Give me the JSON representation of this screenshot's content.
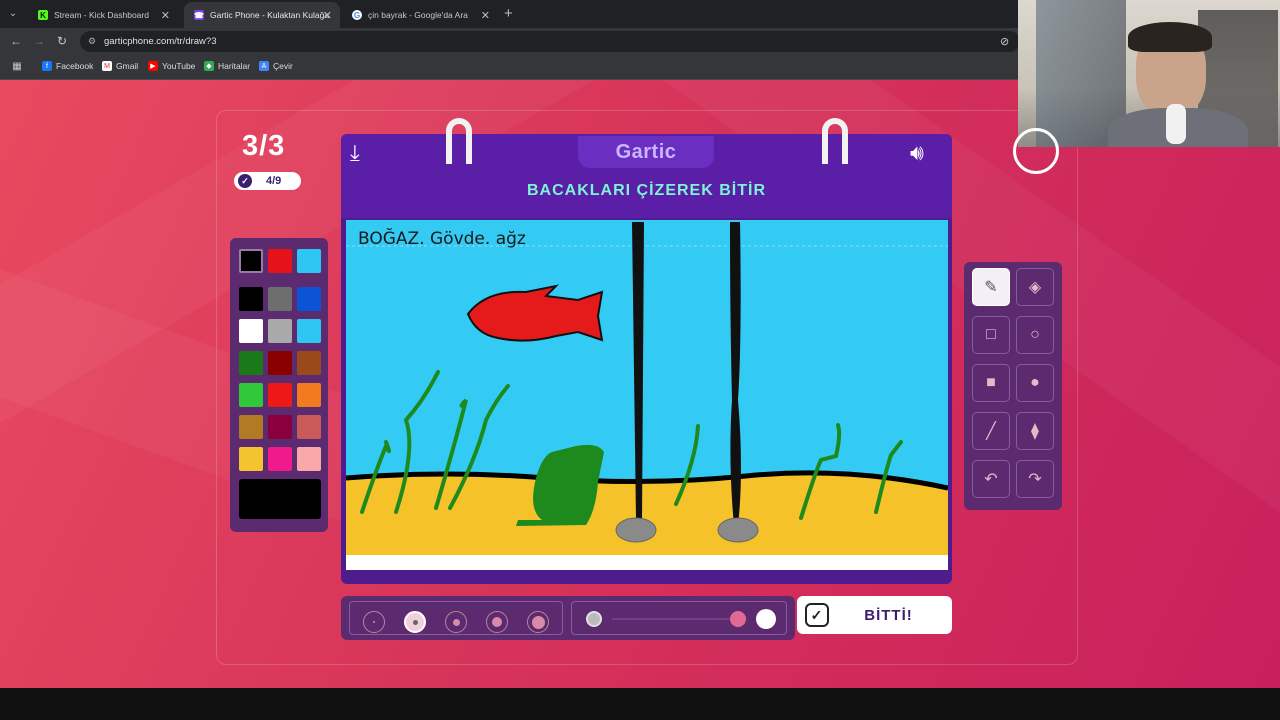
{
  "browser": {
    "tabs": [
      {
        "title": "Stream - Kick Dashboard",
        "icon": "kick-icon",
        "active": false
      },
      {
        "title": "Gartic Phone - Kulaktan Kulağa",
        "icon": "gartic-icon",
        "active": true
      },
      {
        "title": "çin bayrak - Google'da Ara",
        "icon": "google-icon",
        "active": false
      }
    ],
    "url": "garticphone.com/tr/draw?3",
    "bookmarks": [
      "Facebook",
      "Gmail",
      "YouTube",
      "Haritalar",
      "Çevir"
    ]
  },
  "game": {
    "round": "3/3",
    "done_count": "4/9",
    "logo": "Gartic",
    "prompt": "BACAKLARI ÇİZEREK BİTİR",
    "canvas_text": "BOĞAZ. Gövde. ağz",
    "done_label": "BİTTİ!",
    "palette": [
      "#000000",
      "#e5121a",
      "#2ec6f2",
      "#000000",
      "#6e6e6e",
      "#0b54d6",
      "#ffffff",
      "#a9a9a9",
      "#2ec6f2",
      "#1a7a1a",
      "#8a0000",
      "#9a4a1a",
      "#2ec83a",
      "#ef1818",
      "#f47a20",
      "#b27a22",
      "#8a003e",
      "#c85a5a",
      "#f4c430",
      "#f01a8c",
      "#f8a8a8"
    ],
    "selected_color": "#000000",
    "tools": [
      "pencil-icon",
      "eraser-icon",
      "rectangle-outline-icon",
      "circle-outline-icon",
      "rectangle-fill-icon",
      "circle-fill-icon",
      "line-icon",
      "fill-bucket-icon",
      "undo-icon",
      "redo-icon"
    ],
    "brush_sizes": 5,
    "selected_size": 2
  },
  "colors": {
    "page_bg": "#d7345a",
    "panel": "#5c2a6e",
    "notebook": "#5a1fa6",
    "prompt_text": "#7cf3d6",
    "sky": "#33cbf4",
    "sand": "#f5c22a"
  }
}
